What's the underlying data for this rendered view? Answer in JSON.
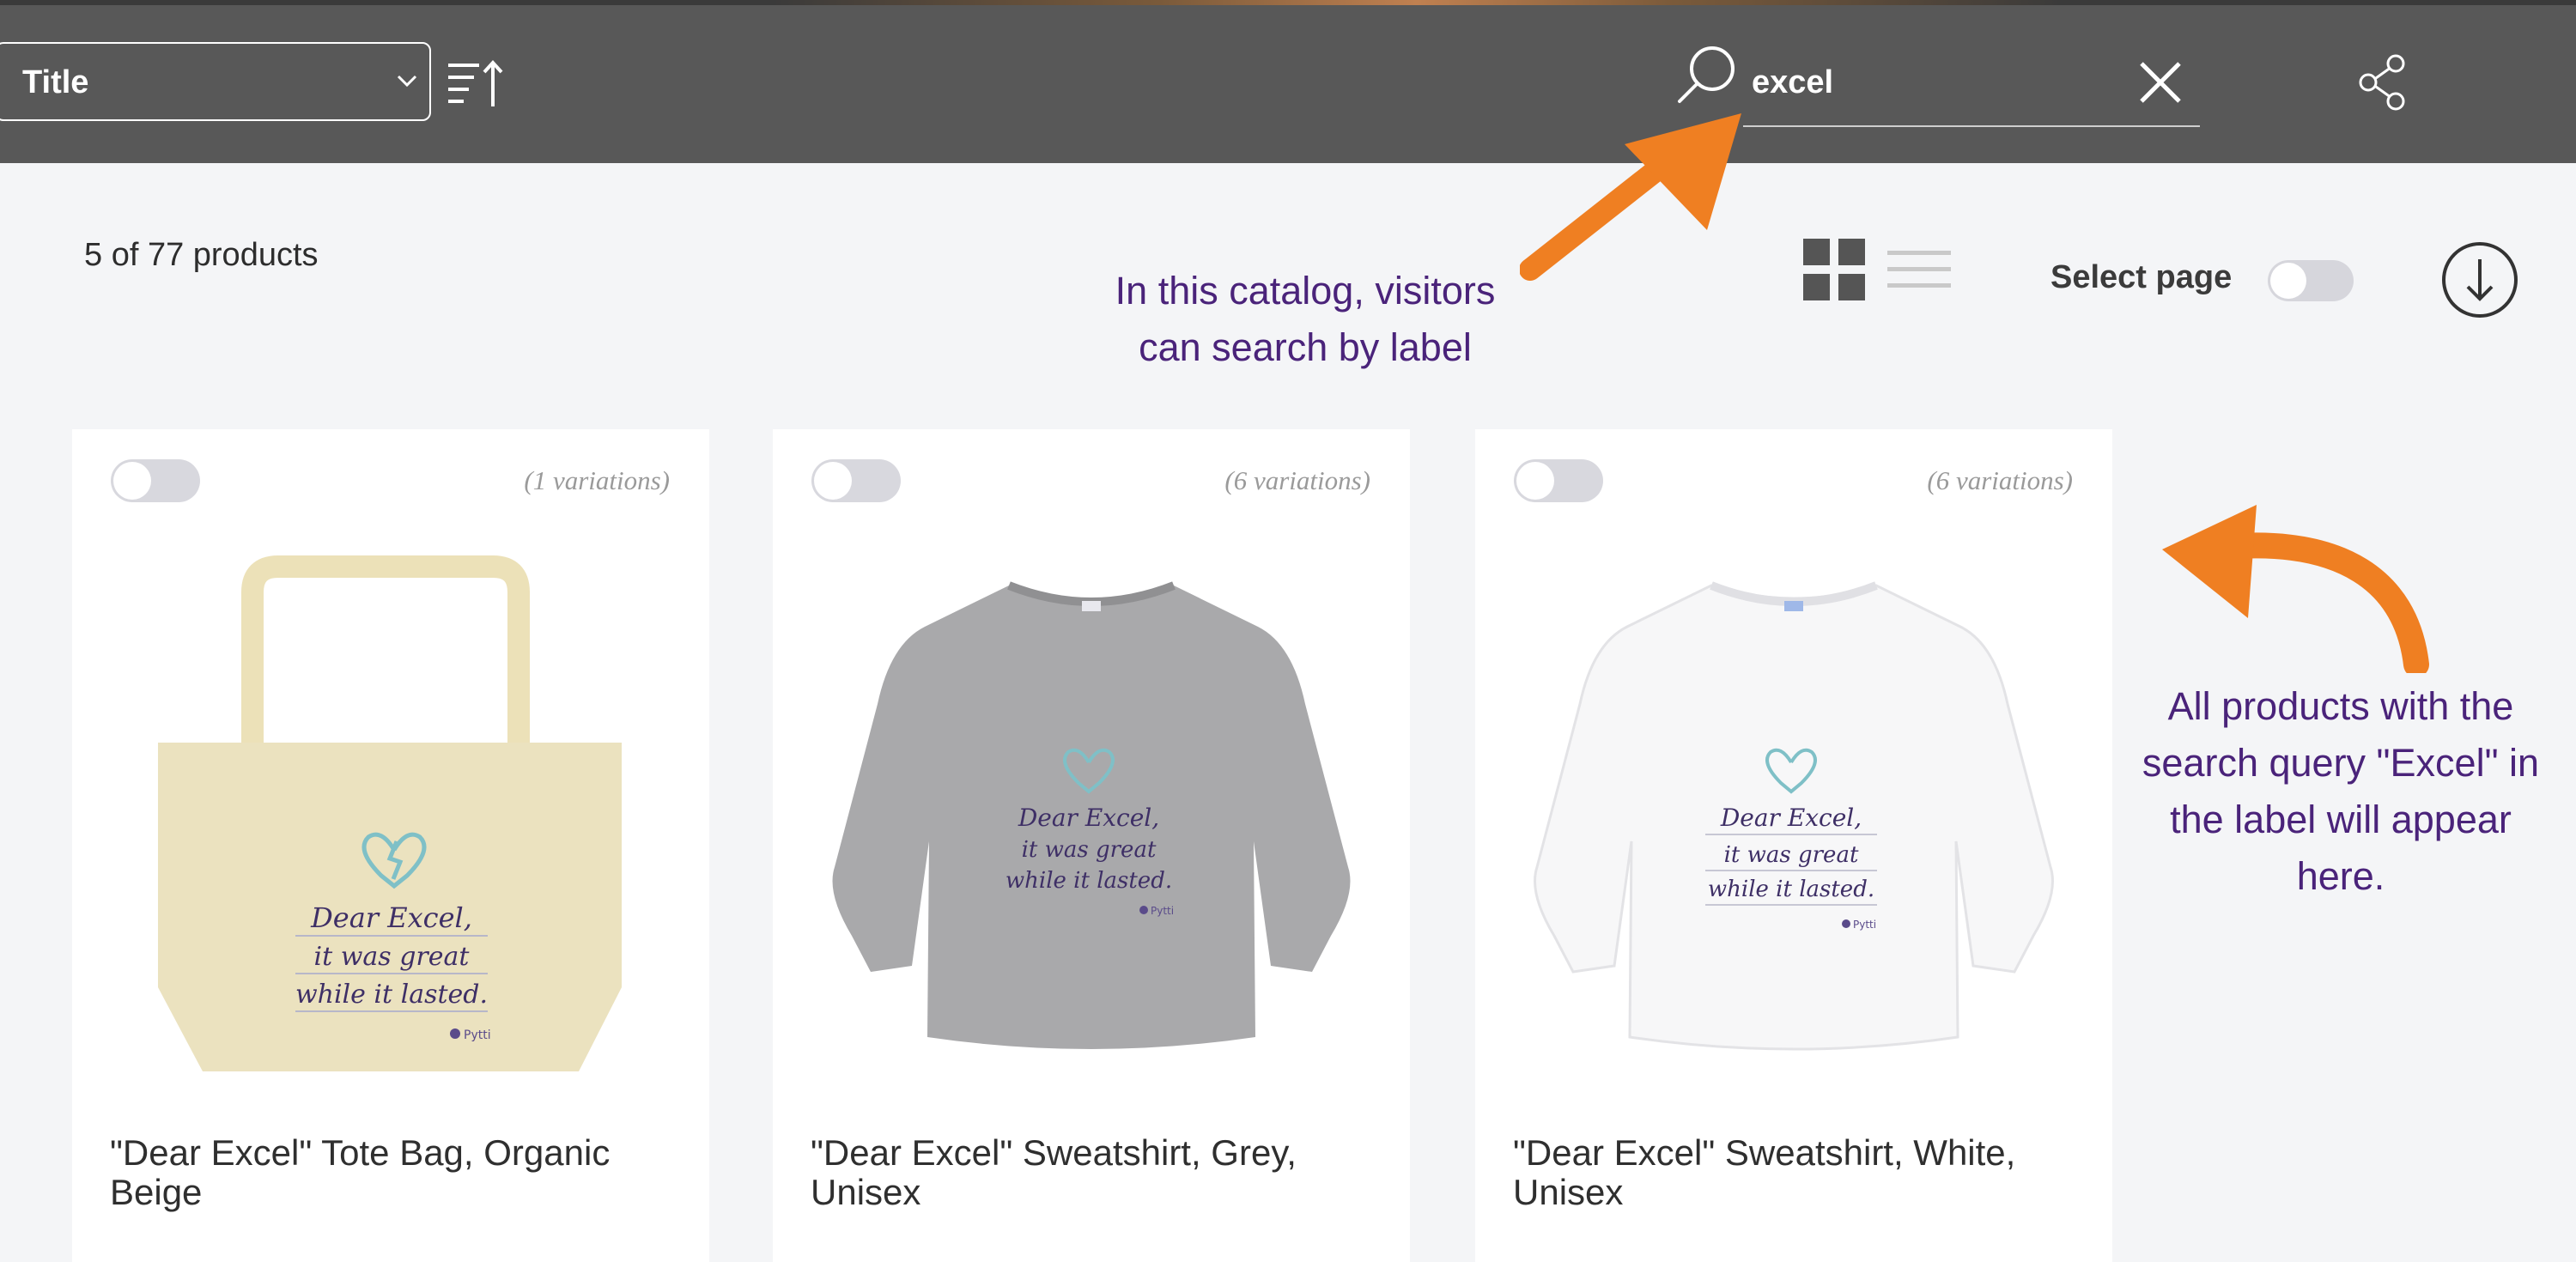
{
  "toolbar": {
    "sort_field": "Title",
    "search_value": "excel",
    "search_placeholder": "Search"
  },
  "catalog": {
    "count_text": "5 of 77 products",
    "select_page_label": "Select page"
  },
  "products": [
    {
      "variations": "(1 variations)",
      "title": "\"Dear Excel\" Tote Bag, Organic Beige"
    },
    {
      "variations": "(6 variations)",
      "title": "\"Dear Excel\" Sweatshirt, Grey, Unisex"
    },
    {
      "variations": "(6 variations)",
      "title": "\"Dear Excel\" Sweatshirt, White, Unisex"
    }
  ],
  "product_print": {
    "line1": "Dear Excel,",
    "line2": "it was great",
    "line3": "while it lasted.",
    "brand": "Pytti"
  },
  "annotations": {
    "search_line1": "In this catalog, visitors",
    "search_line2": "can search by label",
    "results_line1": "All products with the",
    "results_line2": "search query \"Excel\" in",
    "results_line3": "the label will appear",
    "results_line4": "here."
  },
  "colors": {
    "toolbar_bg": "#585858",
    "page_bg": "#f4f5f7",
    "annotation_text": "#4a237a",
    "arrow": "#ef7f22"
  }
}
